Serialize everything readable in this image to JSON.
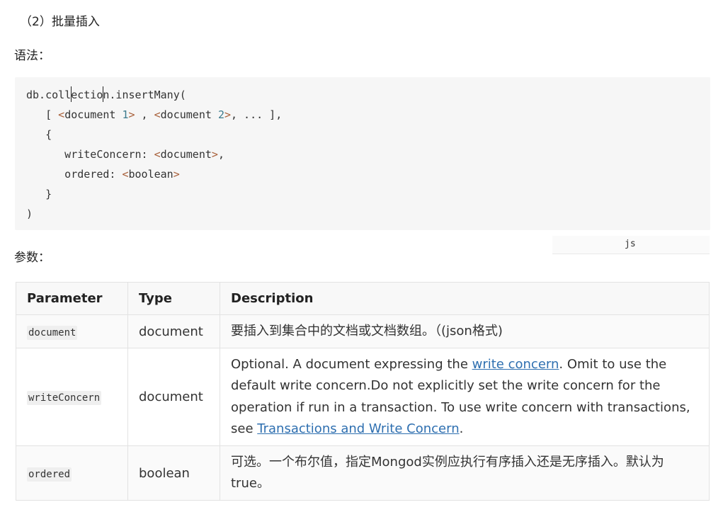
{
  "section_heading": "（2）批量插入",
  "syntax_label": "语法：",
  "code": {
    "language_tag": "js",
    "lines": {
      "l1_pre": "db.col",
      "l1_mid1": "l",
      "l1_mid2": "ectio",
      "l1_post": "n.insertMany(",
      "l2_open": "   [ ",
      "l2_doc1_lt": "<",
      "l2_doc1": "document ",
      "l2_doc1_num": "1",
      "l2_doc1_gt": ">",
      "l2_sep": " , ",
      "l2_doc2_lt": "<",
      "l2_doc2": "document ",
      "l2_doc2_num": "2",
      "l2_doc2_gt": ">",
      "l2_close": ", ... ],",
      "l3": "   {",
      "l4_key": "      writeConcern: ",
      "l4_lt": "<",
      "l4_val": "document",
      "l4_gt": ">",
      "l4_end": ",",
      "l5_key": "      ordered: ",
      "l5_lt": "<",
      "l5_val": "boolean",
      "l5_gt": ">",
      "l6": "   }",
      "l7": ")"
    }
  },
  "params_label": "参数：",
  "table": {
    "headers": [
      "Parameter",
      "Type",
      "Description"
    ],
    "rows": [
      {
        "param": "document",
        "type": "document",
        "description": "要插入到集合中的文档或文档数组。（(json格式)"
      },
      {
        "param": "writeConcern",
        "type": "document",
        "description_parts": {
          "before_link1": "Optional. A document expressing the ",
          "link1": "write concern",
          "after_link1": ". Omit to use the default write concern.Do not explicitly set the write concern for the operation if run in a transaction. To use write concern with transactions, see ",
          "link2": "Transactions and Write Concern",
          "after_link2": "."
        }
      },
      {
        "param": "ordered",
        "type": "boolean",
        "description": "可选。一个布尔值，指定Mongod实例应执行有序插入还是无序插入。默认为true。"
      }
    ]
  },
  "colors": {
    "link": "#2e6fb0",
    "code_background": "#f6f6f6",
    "angle_bracket": "#a8603a",
    "number": "#3c7a8c"
  }
}
